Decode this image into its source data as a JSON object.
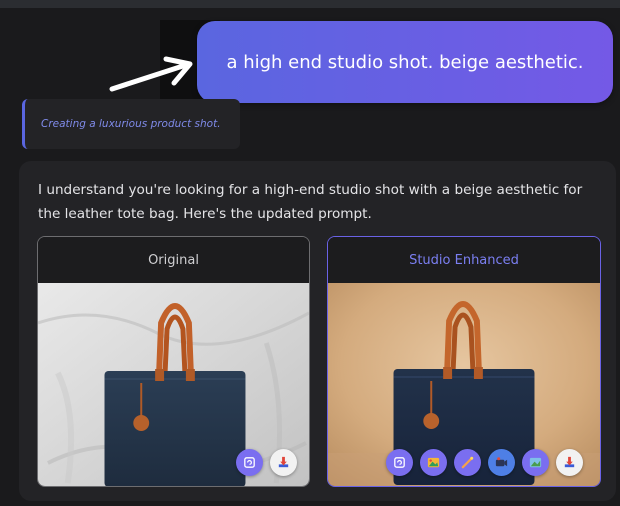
{
  "chat": {
    "user_message": "a high end studio shot. beige aesthetic.",
    "status_text": "Creating a luxurious product shot.",
    "assistant_message": "I understand you're looking for a high-end studio shot with a beige aesthetic for the leather tote bag. Here's the updated prompt."
  },
  "comparison": {
    "original": {
      "label": "Original",
      "actions": [
        {
          "icon": "refresh-icon",
          "color": "#7a6ef0"
        },
        {
          "icon": "download-icon",
          "color": "#f2f2f2"
        }
      ]
    },
    "enhanced": {
      "label": "Studio Enhanced",
      "actions": [
        {
          "icon": "refresh-icon",
          "color": "#7a6ef0"
        },
        {
          "icon": "image-gallery-icon",
          "color": "#7a6ef0"
        },
        {
          "icon": "magic-wand-icon",
          "color": "#7a6ef0"
        },
        {
          "icon": "video-camera-icon",
          "color": "#4e7fe6"
        },
        {
          "icon": "image-edit-icon",
          "color": "#7a6ef0"
        },
        {
          "icon": "download-icon",
          "color": "#f2f2f2"
        }
      ]
    }
  },
  "colors": {
    "accent": "#5a66e0",
    "background": "#1a1a1c",
    "card": "#232326"
  }
}
